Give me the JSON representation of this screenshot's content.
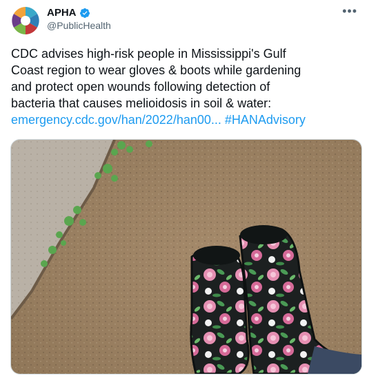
{
  "author": {
    "name": "APHA",
    "handle": "@PublicHealth",
    "verified": true
  },
  "menu_icon": "more-horizontal-icon",
  "tweet": {
    "lines": [
      "CDC advises high-risk people in Mississippi's Gulf",
      "Coast region to wear gloves & boots while gardening",
      "and protect open wounds following detection of",
      "bacteria that causes melioidosis in soil & water:"
    ],
    "link": "emergency.cdc.gov/han/2022/han00...",
    "hashtag": "#HANAdvisory"
  },
  "colors": {
    "link": "#1d9bf0",
    "text": "#0f1419",
    "muted": "#536471",
    "verified": "#1d9bf0"
  }
}
